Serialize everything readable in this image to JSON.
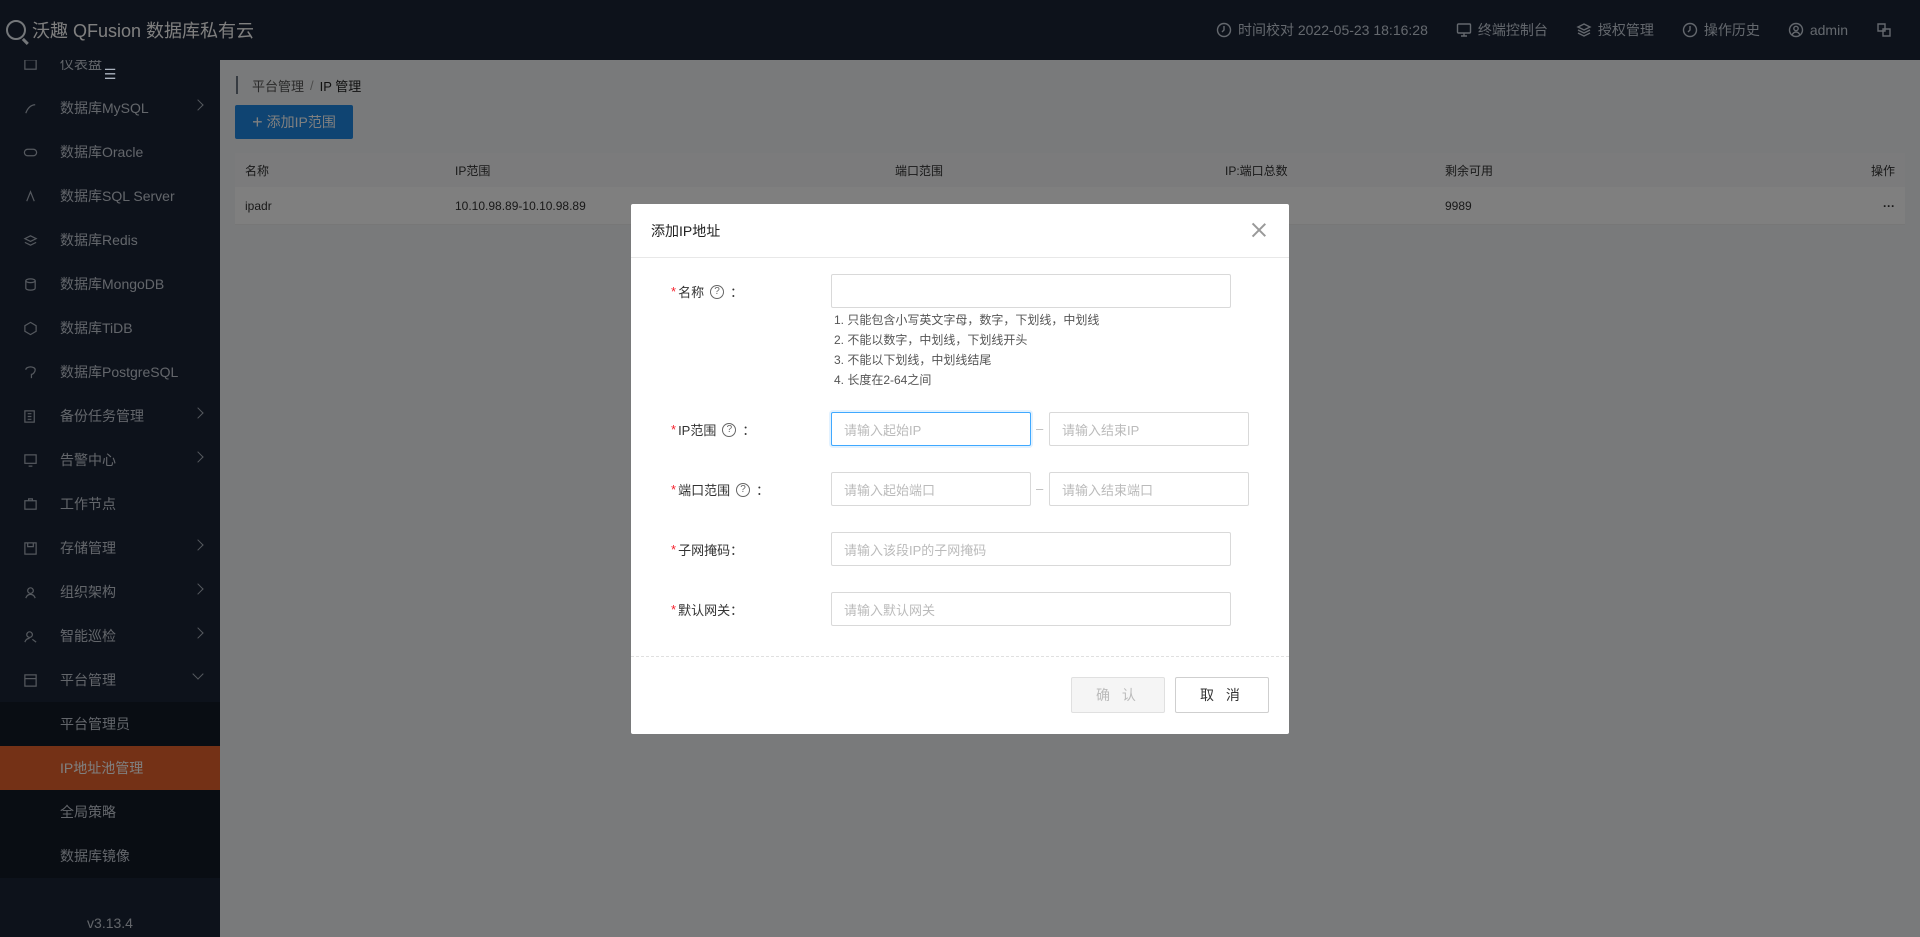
{
  "header": {
    "brand": "沃趣 QFusion 数据库私有云",
    "time_sync": "时间校对 2022-05-23 18:16:28",
    "console": "终端控制台",
    "license": "授权管理",
    "history": "操作历史",
    "user": "admin"
  },
  "sidebar": {
    "items": [
      {
        "label": "仪表盘",
        "icon": "dashboard-icon"
      },
      {
        "label": "数据库MySQL",
        "icon": "mysql-icon"
      },
      {
        "label": "数据库Oracle",
        "icon": "oracle-icon"
      },
      {
        "label": "数据库SQL Server",
        "icon": "sqlserver-icon"
      },
      {
        "label": "数据库Redis",
        "icon": "redis-icon"
      },
      {
        "label": "数据库MongoDB",
        "icon": "mongodb-icon"
      },
      {
        "label": "数据库TiDB",
        "icon": "tidb-icon"
      },
      {
        "label": "数据库PostgreSQL",
        "icon": "postgresql-icon"
      },
      {
        "label": "备份任务管理",
        "icon": "backup-icon"
      },
      {
        "label": "告警中心",
        "icon": "alarm-icon"
      },
      {
        "label": "工作节点",
        "icon": "node-icon"
      },
      {
        "label": "存储管理",
        "icon": "storage-icon"
      },
      {
        "label": "组织架构",
        "icon": "org-icon"
      },
      {
        "label": "智能巡检",
        "icon": "inspect-icon"
      },
      {
        "label": "平台管理",
        "icon": "platform-icon"
      }
    ],
    "sub_items": [
      "平台管理员",
      "IP地址池管理",
      "全局策略",
      "数据库镜像"
    ],
    "version": "v3.13.4"
  },
  "main": {
    "breadcrumb_parent": "平台管理",
    "breadcrumb_current": "IP 管理",
    "add_button": "添加IP范围",
    "table": {
      "headers": [
        "名称",
        "IP范围",
        "端口范围",
        "IP:端口总数",
        "剩余可用",
        "操作"
      ],
      "rows": [
        {
          "name": "ipadr",
          "ip_range": "10.10.98.89-10.10.98.89",
          "port_range": "",
          "total": "",
          "available": "9989",
          "action": "···"
        }
      ]
    }
  },
  "modal": {
    "title": "添加IP地址",
    "name_label": "名称",
    "name_hints": [
      "1. 只能包含小写英文字母，数字，下划线，中划线",
      "2. 不能以数字，中划线，下划线开头",
      "3. 不能以下划线，中划线结尾",
      "4. 长度在2-64之间"
    ],
    "ip_label": "IP范围",
    "ip_start_placeholder": "请输入起始IP",
    "ip_end_placeholder": "请输入结束IP",
    "port_label": "端口范围",
    "port_start_placeholder": "请输入起始端口",
    "port_end_placeholder": "请输入结束端口",
    "mask_label": "子网掩码",
    "mask_placeholder": "请输入该段IP的子网掩码",
    "gateway_label": "默认网关",
    "gateway_placeholder": "请输入默认网关",
    "ok": "确 认",
    "cancel": "取 消",
    "colon": "：",
    "dash": "–",
    "help_glyph": "?"
  },
  "colors": {
    "header_bg": "#1b2536",
    "active_menu": "#e8622c",
    "primary": "#1e88e5"
  }
}
